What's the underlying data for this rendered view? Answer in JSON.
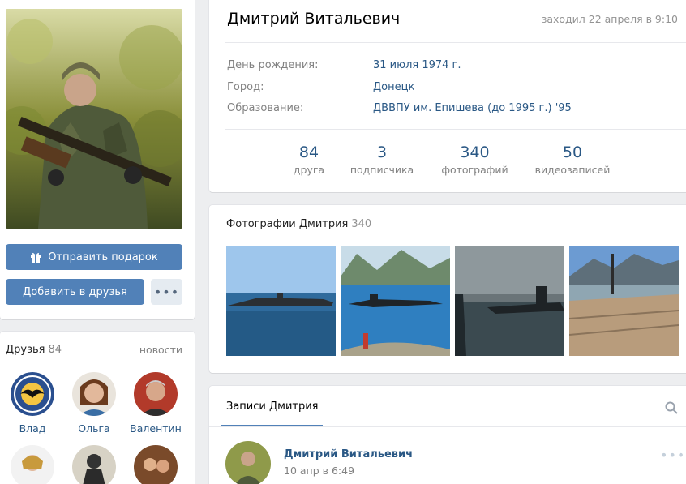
{
  "profile": {
    "name": "Дмитрий Витальевич",
    "last_seen": "заходил 22 апреля в 9:10",
    "info": [
      {
        "label": "День рождения:",
        "value": "31 июля 1974 г."
      },
      {
        "label": "Город:",
        "value": "Донецк"
      },
      {
        "label": "Образование:",
        "value": "ДВВПУ им. Епишева (до 1995 г.) '95"
      }
    ],
    "counters": [
      {
        "num": "84",
        "label": "друга"
      },
      {
        "num": "3",
        "label": "подписчика"
      },
      {
        "num": "340",
        "label": "фотографий"
      },
      {
        "num": "50",
        "label": "видеозаписей"
      }
    ]
  },
  "actions": {
    "gift_label": "Отправить подарок",
    "add_friend_label": "Добавить в друзья",
    "more_label": "•••"
  },
  "friends": {
    "title": "Друзья",
    "count": "84",
    "news_link": "новости",
    "items": [
      {
        "name": "Влад"
      },
      {
        "name": "Ольга"
      },
      {
        "name": "Валентин"
      }
    ]
  },
  "photos": {
    "title": "Фотографии Дмитрия",
    "count": "340"
  },
  "wall": {
    "tab": "Записи Дмитрия",
    "post": {
      "author": "Дмитрий Витальевич",
      "date": "10 апр в 6:49",
      "more": "•••"
    }
  },
  "colors": {
    "accent": "#5181b8",
    "link": "#2a5885",
    "muted": "#828282",
    "page_bg": "#edeef0"
  }
}
